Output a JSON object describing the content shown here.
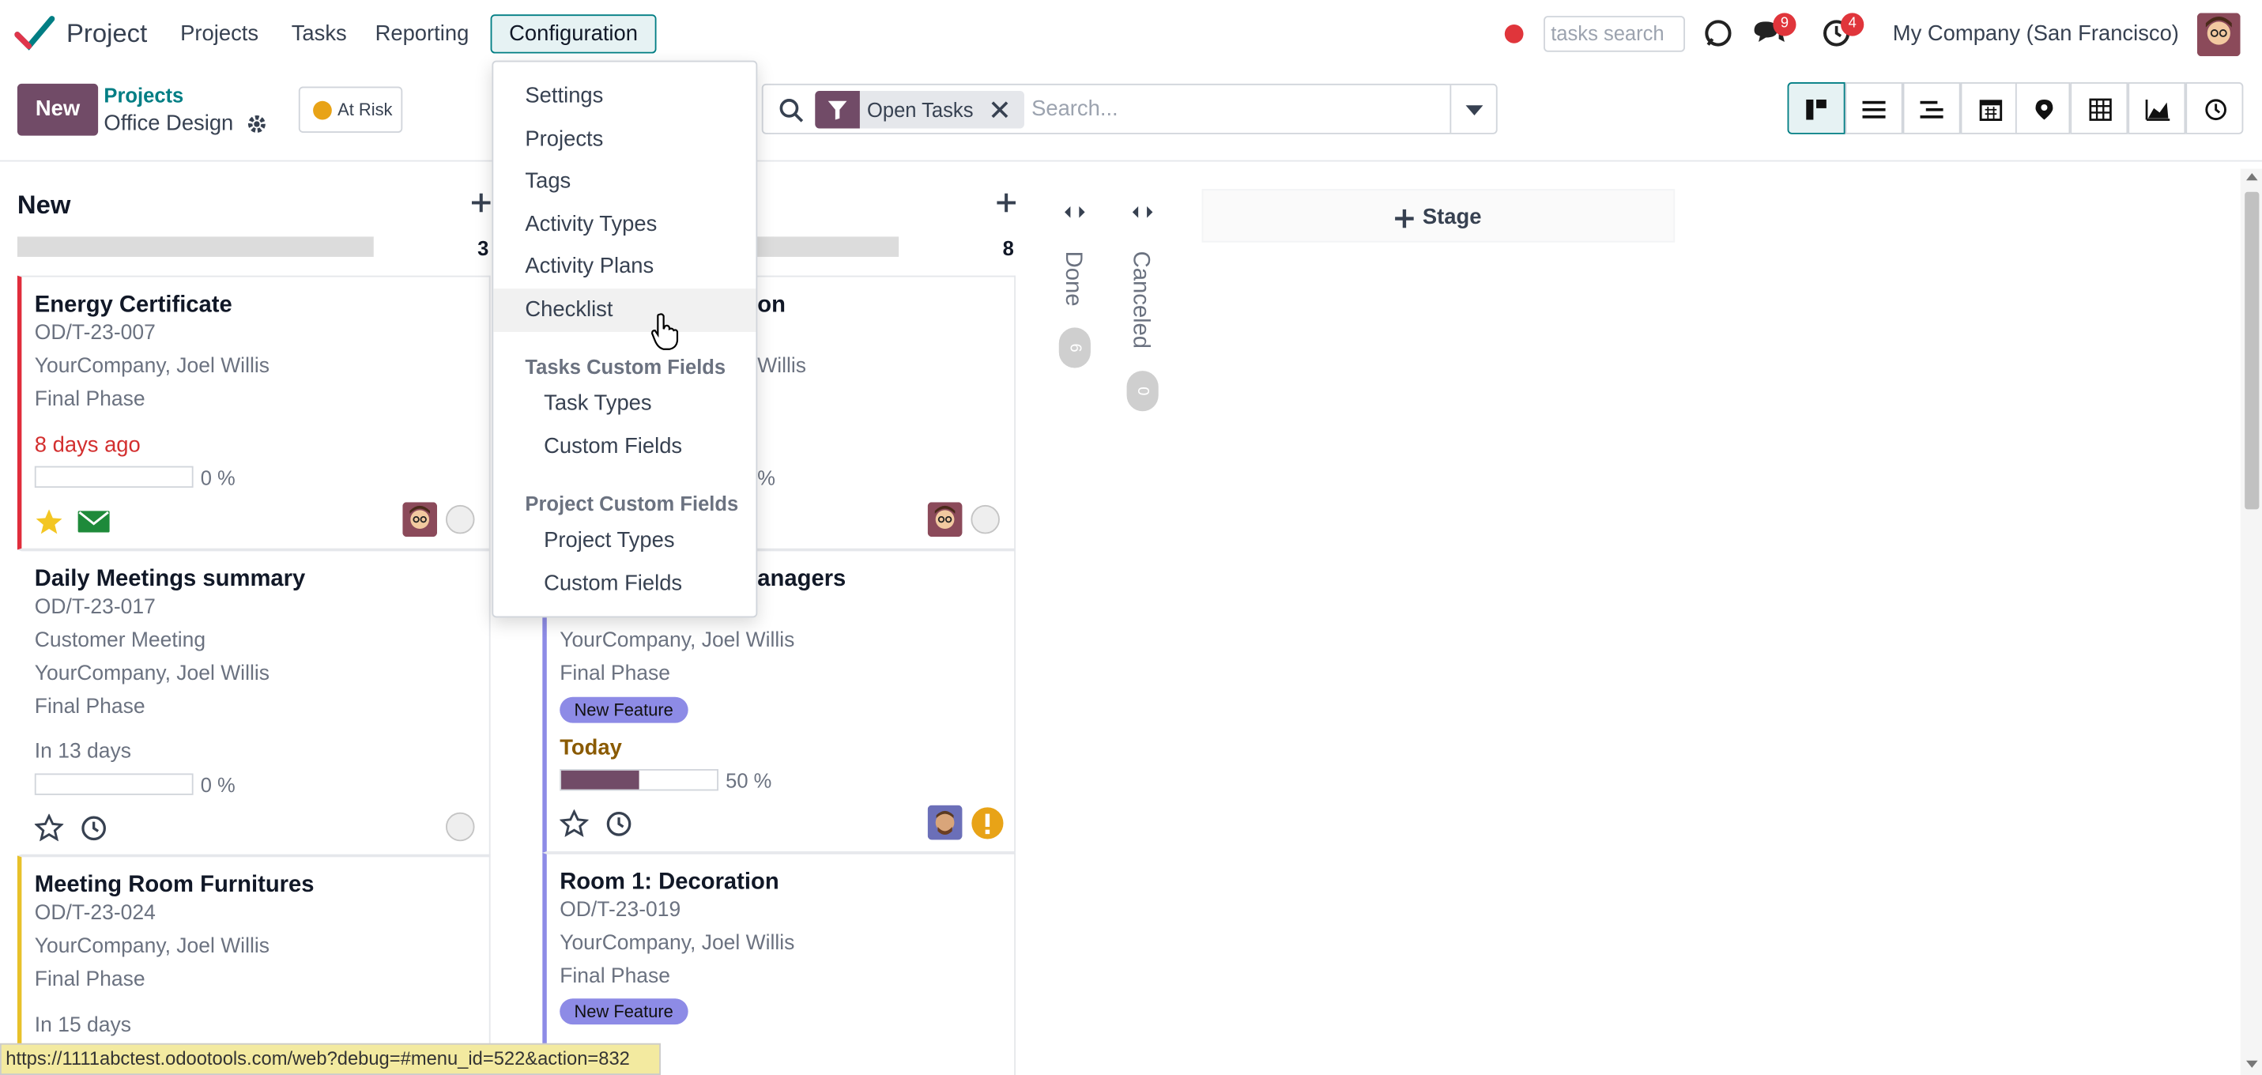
{
  "navbar": {
    "app_name": "Project",
    "menus": [
      "Projects",
      "Tasks",
      "Reporting"
    ],
    "active_menu": "Configuration",
    "search_placeholder": "tasks search",
    "messages_badge": "9",
    "activities_badge": "4",
    "company": "My Company (San Francisco)"
  },
  "control_panel": {
    "new_label": "New",
    "breadcrumb_parent": "Projects",
    "breadcrumb_current": "Office Design",
    "status_label": "At Risk",
    "status_color": "#e8a317",
    "facet_label": "Open Tasks",
    "search_placeholder": "Search..."
  },
  "config_menu": {
    "items": [
      "Settings",
      "Projects",
      "Tags",
      "Activity Types",
      "Activity Plans",
      "Checklist"
    ],
    "hovered": "Checklist",
    "tasks_custom_header": "Tasks Custom Fields",
    "tasks_custom_items": [
      "Task Types",
      "Custom Fields"
    ],
    "project_custom_header": "Project Custom Fields",
    "project_custom_items": [
      "Project Types",
      "Custom Fields"
    ]
  },
  "kanban": {
    "columns": [
      {
        "title": "New",
        "count": "3",
        "cards": [
          {
            "title": "Energy Certificate",
            "ref": "OD/T-23-007",
            "customer": "YourCompany, Joel Willis",
            "phase": "Final Phase",
            "deadline": "8 days ago",
            "progress_label": "0 %",
            "progress": 0
          },
          {
            "title": "Daily Meetings summary",
            "ref": "OD/T-23-017",
            "type": "Customer Meeting",
            "customer": "YourCompany, Joel Willis",
            "phase": "Final Phase",
            "deadline": "In 13 days",
            "progress_label": "0 %",
            "progress": 0
          },
          {
            "title": "Meeting Room Furnitures",
            "ref": "OD/T-23-024",
            "customer": "YourCompany, Joel Willis",
            "phase": "Final Phase",
            "deadline": "In 15 days"
          }
        ]
      },
      {
        "title": "",
        "count": "8",
        "cards": [
          {
            "title_partial": "on",
            "customer_partial": "Willis",
            "progress_partial": "%"
          },
          {
            "title_partial": "anagers",
            "customer": "YourCompany, Joel Willis",
            "phase": "Final Phase",
            "tag": "New Feature",
            "deadline": "Today",
            "progress_label": "50 %",
            "progress": 0.5
          },
          {
            "title": "Room 1: Decoration",
            "ref": "OD/T-23-019",
            "customer": "YourCompany, Joel Willis",
            "phase": "Final Phase",
            "tag": "New Feature"
          }
        ]
      }
    ],
    "folded": [
      {
        "title": "Done",
        "count": "6"
      },
      {
        "title": "Canceled",
        "count": "0"
      }
    ],
    "add_stage_label": "Stage"
  },
  "status_url": "https://1111abctest.odootools.com/web?debug=#menu_id=522&action=832",
  "colors": {
    "brand": "#714b67",
    "accent": "#017e84",
    "overdue": "#d32f2f",
    "today": "#8a5a00",
    "tag": "#8d8be6"
  }
}
